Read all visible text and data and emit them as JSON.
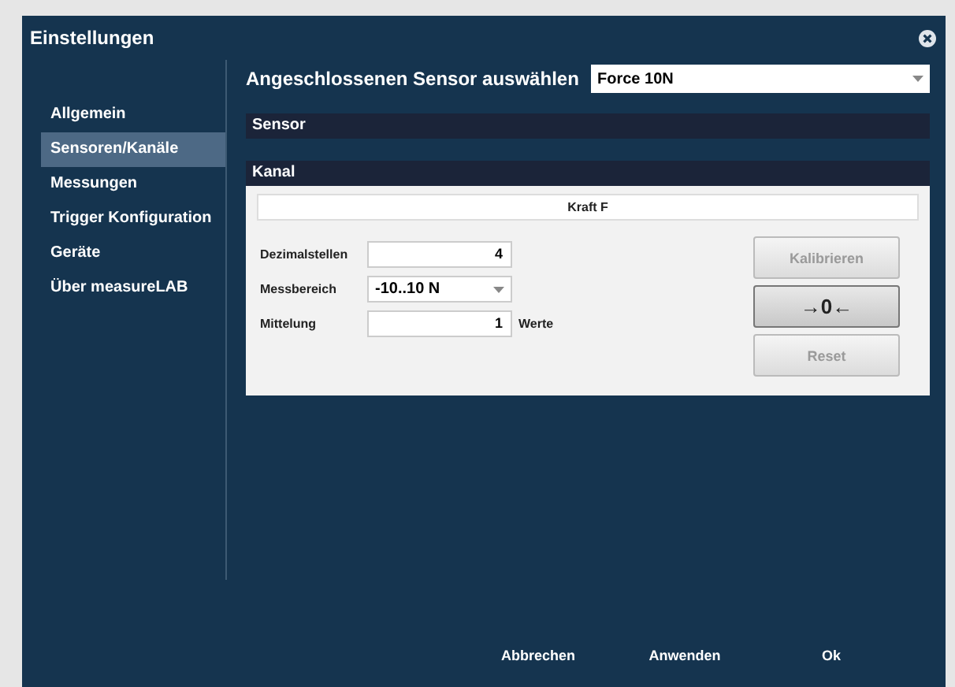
{
  "window": {
    "title": "Einstellungen"
  },
  "sidebar": {
    "items": [
      {
        "label": "Allgemein",
        "selected": false
      },
      {
        "label": "Sensoren/Kanäle",
        "selected": true
      },
      {
        "label": "Messungen",
        "selected": false
      },
      {
        "label": "Trigger Konfiguration",
        "selected": false
      },
      {
        "label": "Geräte",
        "selected": false
      },
      {
        "label": "Über measureLAB",
        "selected": false
      }
    ]
  },
  "sensor_select": {
    "label": "Angeschlossenen Sensor auswählen",
    "value": "Force 10N"
  },
  "sensor_section": {
    "title": "Sensor"
  },
  "channel_section": {
    "title": "Kanal",
    "channel_name": "Kraft F",
    "fields": [
      {
        "kind": "input",
        "label": "Dezimalstellen",
        "value": "4"
      },
      {
        "kind": "dropdown",
        "label": "Messbereich",
        "value": "-10..10 N"
      },
      {
        "kind": "input",
        "label": "Mittelung",
        "value": "1",
        "unit": "Werte"
      }
    ],
    "buttons": [
      {
        "label": "Kalibrieren",
        "disabled": true
      },
      {
        "label": "→0←",
        "disabled": false
      },
      {
        "label": "Reset",
        "disabled": true
      }
    ]
  },
  "footer_buttons": [
    "Abbrechen",
    "Anwenden",
    "Ok"
  ]
}
